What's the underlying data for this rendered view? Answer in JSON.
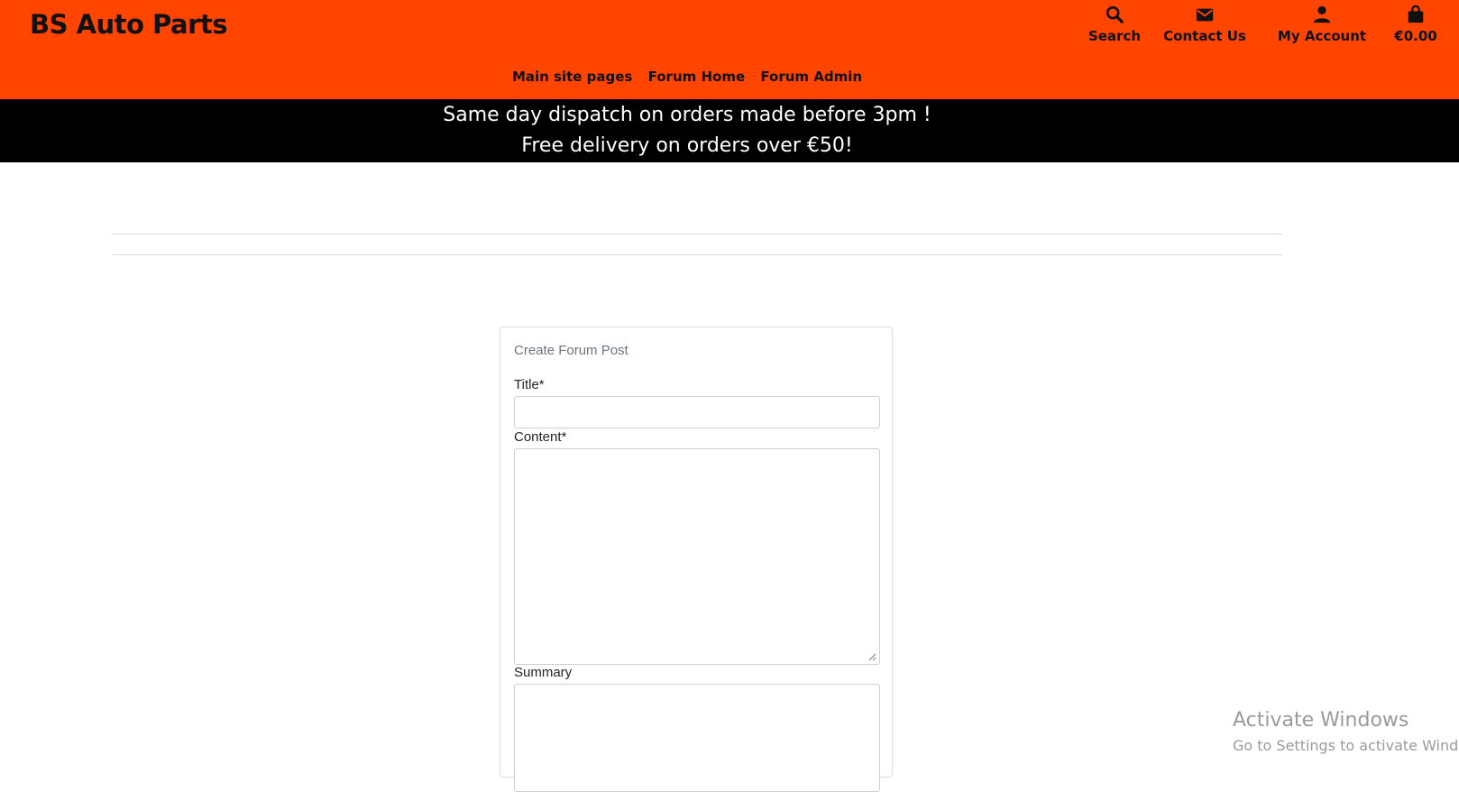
{
  "header": {
    "brand": "BS Auto Parts",
    "brand_color": "#ff4500",
    "icons": [
      {
        "label": "Search",
        "icon": "search-icon"
      },
      {
        "label": "Contact Us",
        "icon": "envelope-icon"
      },
      {
        "label": "My Account",
        "icon": "user-icon"
      },
      {
        "label": "€0.00",
        "icon": "shopping-bag-icon"
      }
    ],
    "nav": [
      "Main site pages",
      "Forum Home",
      "Forum Admin"
    ]
  },
  "banner": {
    "line1": "Same day dispatch on orders made before 3pm !",
    "line2": "Free delivery on orders over €50!"
  },
  "form": {
    "title": "Create Forum Post",
    "fields": [
      {
        "label": "Title*",
        "value": ""
      },
      {
        "label": "Content*",
        "value": ""
      },
      {
        "label": "Summary",
        "value": ""
      }
    ]
  },
  "watermark": {
    "line1": "Activate Windows",
    "line2": "Go to Settings to activate Windows."
  }
}
